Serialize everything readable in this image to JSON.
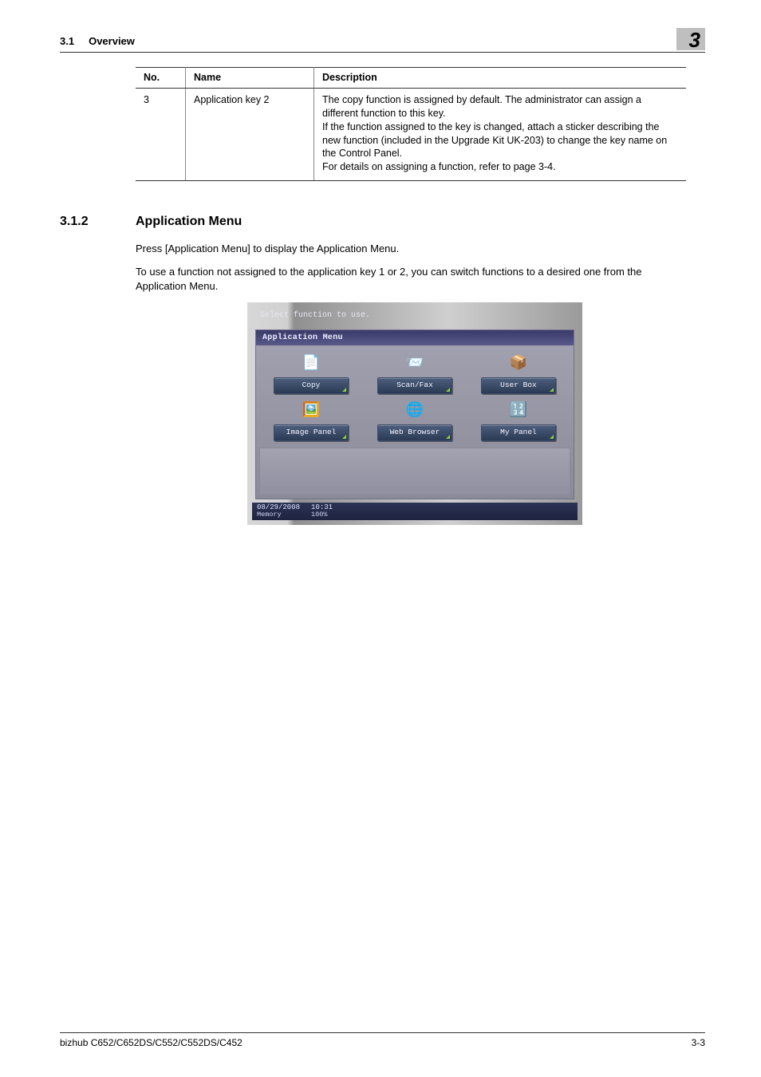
{
  "header": {
    "section_no": "3.1",
    "section_title": "Overview",
    "chapter_no": "3"
  },
  "table": {
    "headers": {
      "no": "No.",
      "name": "Name",
      "desc": "Description"
    },
    "row": {
      "no": "3",
      "name": "Application key 2",
      "desc": "The copy function is assigned by default. The administrator can assign a different function to this key.\nIf the function assigned to the key is changed, attach a sticker describing the new function (included in the Upgrade Kit UK-203) to change the key name on the Control Panel.\nFor details on assigning a function, refer to page 3-4."
    }
  },
  "section": {
    "no": "3.1.2",
    "title": "Application Menu",
    "p1": "Press [Application Menu] to display the Application Menu.",
    "p2": "To use a function not assigned to the application key 1 or 2, you can switch functions to a desired one from the Application Menu."
  },
  "device": {
    "hint": "Select function to use.",
    "panelTitle": "Application Menu",
    "items": [
      {
        "label": "Copy",
        "iconGlyph": "📄",
        "iconName": "copy-icon"
      },
      {
        "label": "Scan/Fax",
        "iconGlyph": "📨",
        "iconName": "scan-fax-icon"
      },
      {
        "label": "User Box",
        "iconGlyph": "📦",
        "iconName": "user-box-icon"
      },
      {
        "label": "Image Panel",
        "iconGlyph": "🖼️",
        "iconName": "image-panel-icon"
      },
      {
        "label": "Web Browser",
        "iconGlyph": "🌐",
        "iconName": "web-browser-icon"
      },
      {
        "label": "My Panel",
        "iconGlyph": "🔢",
        "iconName": "my-panel-icon"
      }
    ],
    "status": {
      "date": "08/29/2008",
      "time": "10:31",
      "memLabel": "Memory",
      "memValue": "100%"
    }
  },
  "footer": {
    "left": "bizhub C652/C652DS/C552/C552DS/C452",
    "right": "3-3"
  }
}
